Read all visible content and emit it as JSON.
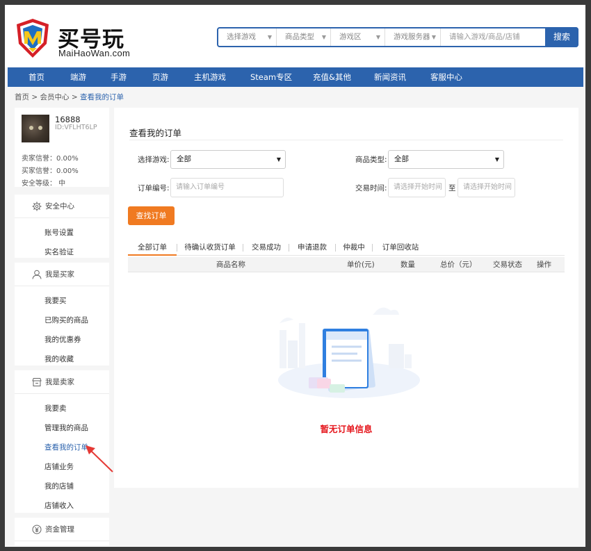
{
  "brand": {
    "title": "买号玩",
    "subtitle": "MaiHaoWan.com",
    "primary_color": "#2c63ad",
    "accent_color": "#f07a21"
  },
  "search": {
    "filters": [
      "选择游戏",
      "商品类型",
      "游戏区",
      "游戏服务器"
    ],
    "placeholder": "请输入游戏/商品/店铺",
    "button": "搜索"
  },
  "nav": {
    "items": [
      "首页",
      "端游",
      "手游",
      "页游",
      "主机游戏",
      "Steam专区",
      "充值&其他",
      "新闻资讯",
      "客服中心"
    ]
  },
  "breadcrumb": {
    "home": "首页",
    "sep": ">",
    "center": "会员中心",
    "current": "查看我的订单"
  },
  "user": {
    "name": "16888",
    "id": "ID:VFLHT6LP",
    "seller_credit": "卖家信誉：0.00%",
    "buyer_credit": "买家信誉：0.00%",
    "security_level": "安全等级：  中"
  },
  "sidebar": {
    "security": {
      "title": "安全中心",
      "items": [
        "账号设置",
        "实名验证"
      ]
    },
    "buyer": {
      "title": "我是买家",
      "items": [
        "我要买",
        "已购买的商品",
        "我的优惠券",
        "我的收藏"
      ]
    },
    "seller": {
      "title": "我是卖家",
      "items": [
        "我要卖",
        "管理我的商品",
        "查看我的订单",
        "店铺业务",
        "我的店铺",
        "店铺收入"
      ],
      "active": "查看我的订单"
    },
    "funds": {
      "title": "资金管理"
    }
  },
  "main": {
    "title": "查看我的订单",
    "filters": {
      "game_label": "选择游戏:",
      "game_value": "全部",
      "type_label": "商品类型:",
      "type_value": "全部",
      "order_label": "订单编号:",
      "order_placeholder": "请输入订单编号",
      "time_label": "交易时间:",
      "time_start_placeholder": "请选择开始时间",
      "time_to": "至",
      "time_end_placeholder": "请选择开始时间"
    },
    "query_button": "查找订单",
    "tabs": [
      "全部订单",
      "待确认收货订单",
      "交易成功",
      "申请退款",
      "仲裁中",
      "订单回收站"
    ],
    "active_tab": "全部订单",
    "columns": [
      "商品名称",
      "单价(元)",
      "数量",
      "总价（元）",
      "交易状态",
      "操作"
    ],
    "empty_text": "暂无订单信息"
  }
}
